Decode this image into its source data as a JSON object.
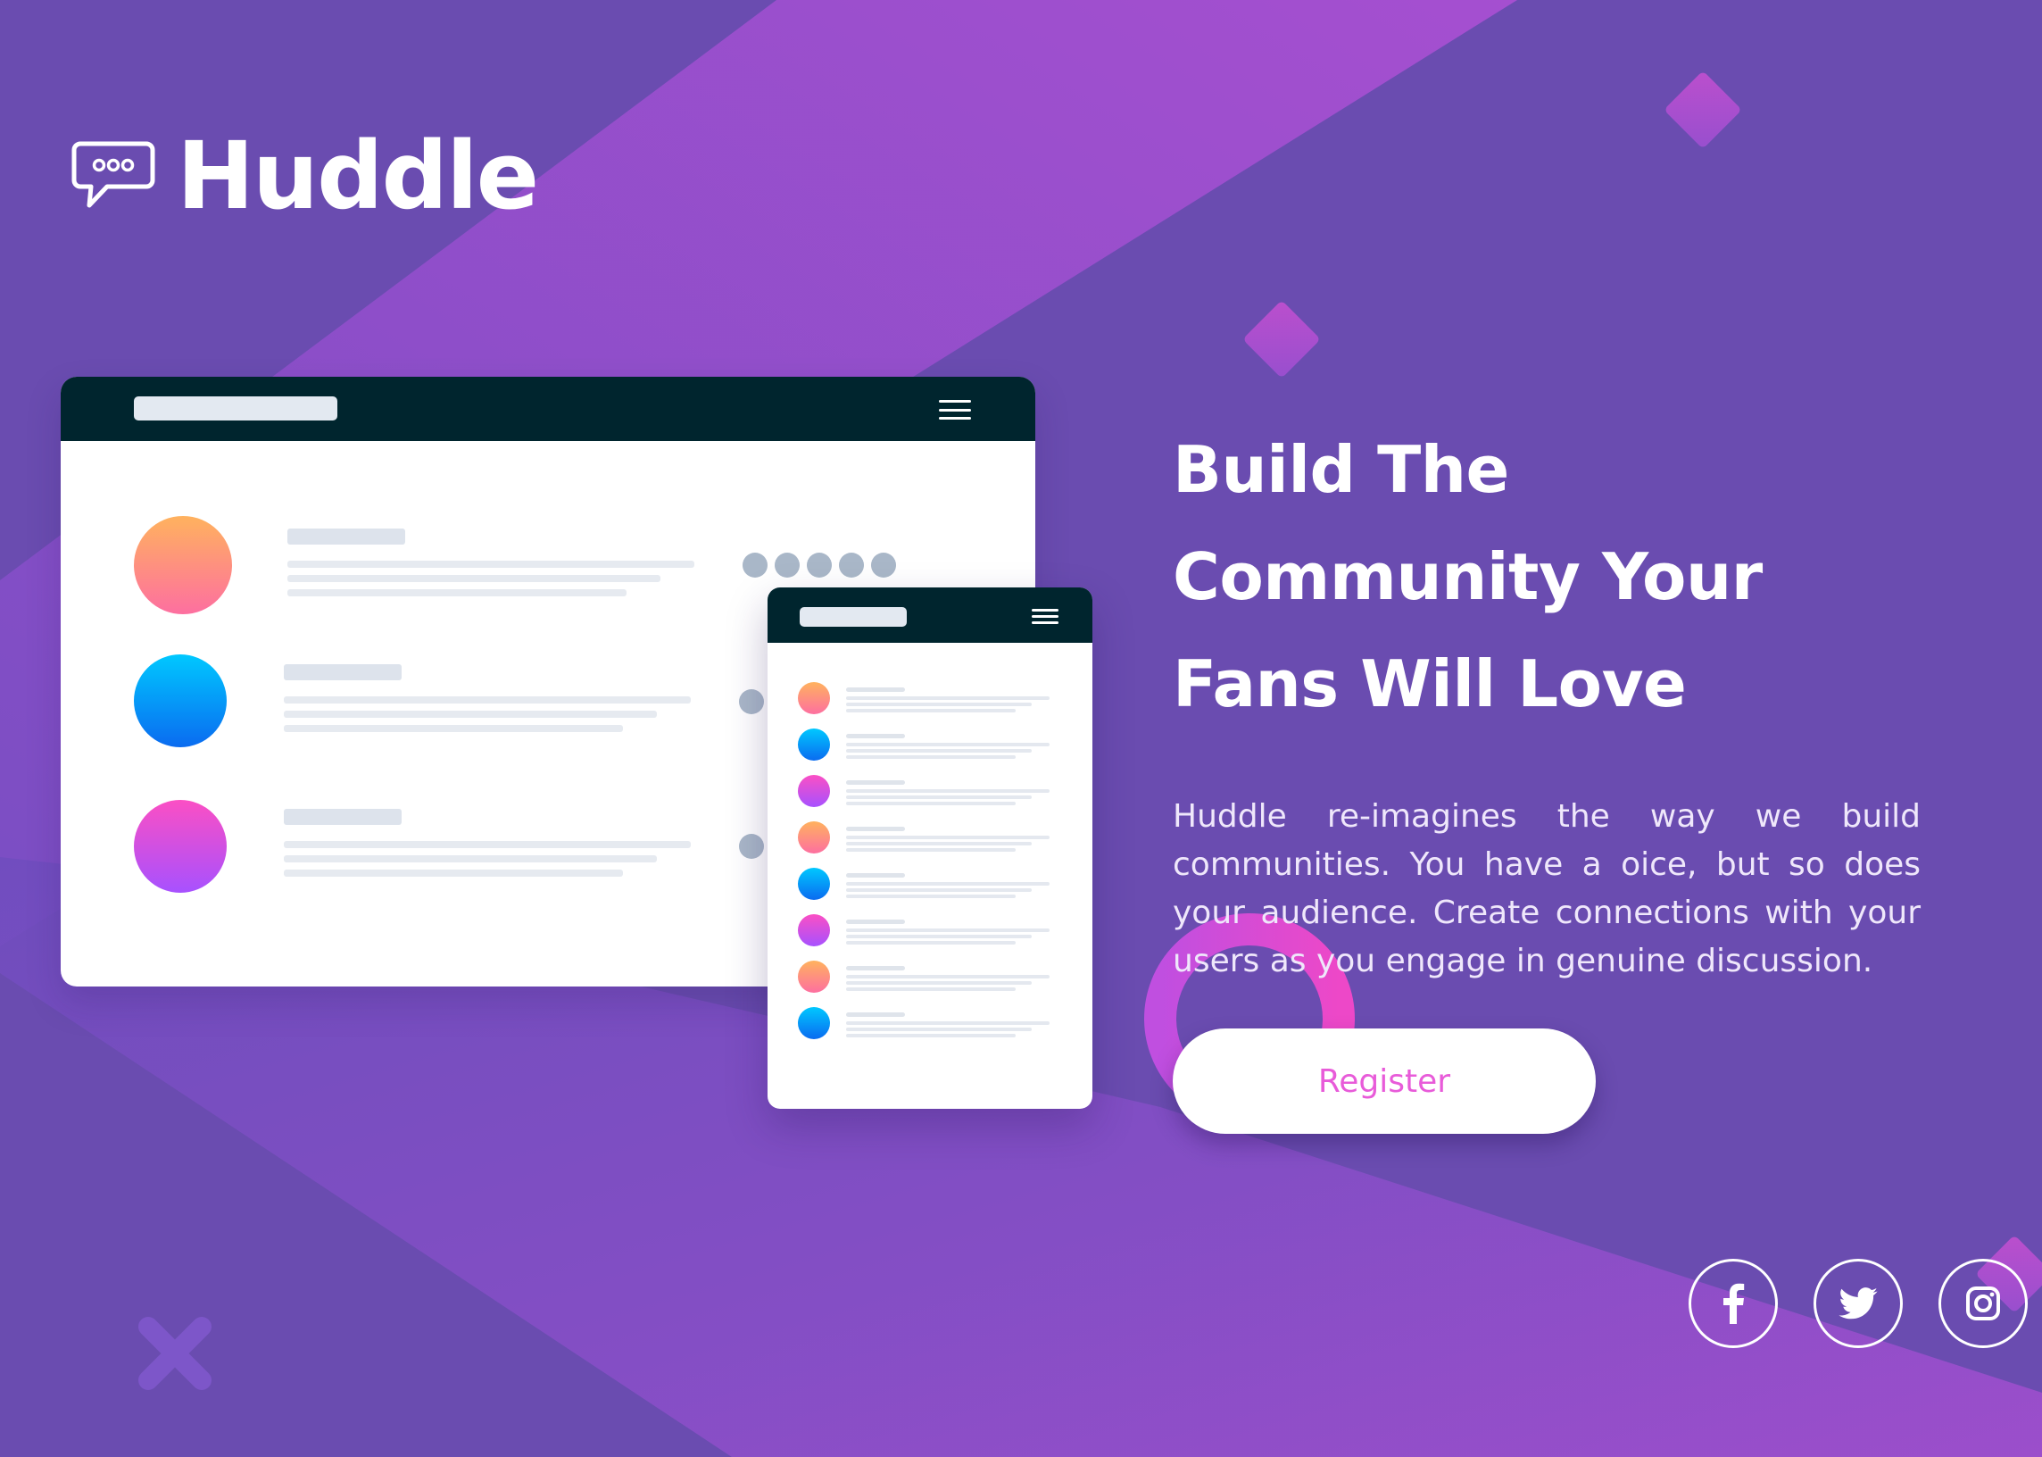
{
  "brand": {
    "name": "Huddle",
    "logo_icon": "chat-bubble-icon"
  },
  "hero": {
    "title": "Build The\nCommunity Your\nFans Will Love",
    "description": "Huddle re-imagines the way we build communities. You have a oice, but so does your audience. Create connections with your users as you engage in genuine discussion.",
    "register_label": "Register"
  },
  "social": [
    {
      "name": "facebook",
      "icon": "facebook-icon"
    },
    {
      "name": "twitter",
      "icon": "twitter-icon"
    },
    {
      "name": "instagram",
      "icon": "instagram-icon"
    }
  ],
  "colors": {
    "background": "#6a4cb0",
    "accent_pink": "#e85bd9",
    "mock_header": "#00252e",
    "white": "#ffffff"
  }
}
